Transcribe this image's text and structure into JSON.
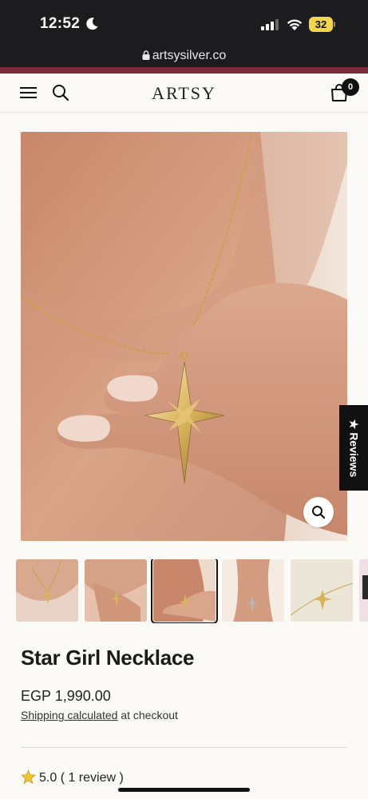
{
  "status_bar": {
    "time": "12:52",
    "battery": "32",
    "moon_icon": "moon-icon",
    "signal_icon": "cellular-signal-icon",
    "wifi_icon": "wifi-icon"
  },
  "browser": {
    "url": "artsysilver.co",
    "lock_icon": "lock-icon"
  },
  "header": {
    "logo": "ARTSY",
    "cart_count": "0",
    "menu_icon": "hamburger-menu-icon",
    "search_icon": "search-icon",
    "cart_icon": "shopping-bag-icon"
  },
  "gallery": {
    "zoom_icon": "magnifier-icon",
    "thumbnails": [
      {
        "alt": "thumbnail-1"
      },
      {
        "alt": "thumbnail-2"
      },
      {
        "alt": "thumbnail-3",
        "selected": true
      },
      {
        "alt": "thumbnail-4"
      },
      {
        "alt": "thumbnail-5"
      },
      {
        "alt": "thumbnail-6"
      }
    ]
  },
  "reviews_tab": {
    "label": "★ Reviews"
  },
  "product": {
    "title": "Star Girl Necklace",
    "price": "EGP 1,990.00",
    "shipping_link": "Shipping calculated",
    "shipping_suffix": " at checkout"
  },
  "rating": {
    "text": "5.0 ( 1 review )",
    "star_icon": "star-icon",
    "star_color": "#f2c12e"
  },
  "colors": {
    "accent": "#7a2a3a",
    "brand_dark": "#111111",
    "background": "#fbfaf6"
  }
}
